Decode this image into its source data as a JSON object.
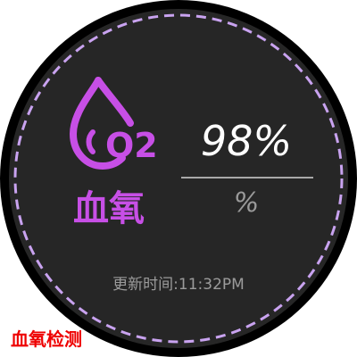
{
  "watch_face": {
    "accent_color": "#c74fe6",
    "background_color": "#262626",
    "icon": {
      "name": "oxygen-drop-icon",
      "text": "O2"
    },
    "metric_label": "血氧",
    "reading": {
      "value": "98%",
      "unit": "%"
    },
    "last_updated": {
      "label": "更新时间:",
      "time": "11:32PM"
    }
  },
  "caption": "血氧检测"
}
